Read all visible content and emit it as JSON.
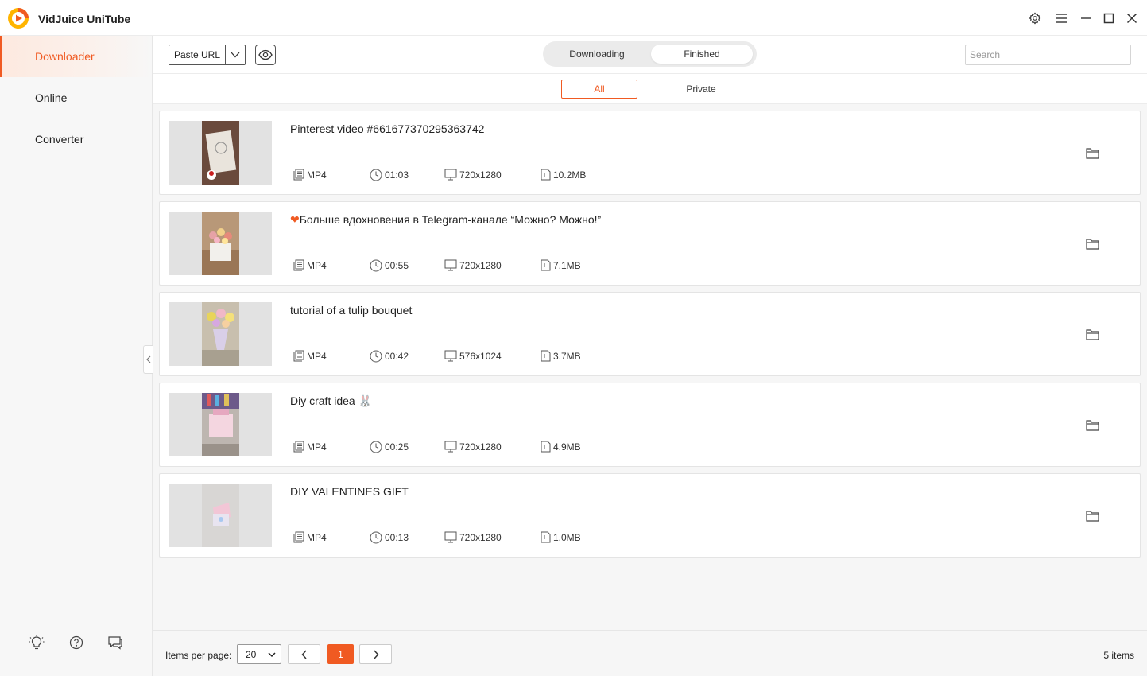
{
  "app": {
    "title": "VidJuice UniTube",
    "accent": "#f05a22"
  },
  "window_controls": [
    "gear-icon",
    "menu-icon",
    "minimize-icon",
    "maximize-icon",
    "close-icon"
  ],
  "sidebar": {
    "items": [
      {
        "label": "Downloader",
        "active": true
      },
      {
        "label": "Online",
        "active": false
      },
      {
        "label": "Converter",
        "active": false
      }
    ],
    "bottom_icons": [
      "lightbulb-icon",
      "help-icon",
      "feedback-icon"
    ]
  },
  "toolbar": {
    "paste_url_label": "Paste URL",
    "tabs": [
      {
        "label": "Downloading",
        "active": false
      },
      {
        "label": "Finished",
        "active": true
      }
    ],
    "search_placeholder": "Search"
  },
  "subtabs": [
    {
      "label": "All",
      "active": true
    },
    {
      "label": "Private",
      "active": false
    }
  ],
  "videos": [
    {
      "title": "Pinterest video #661677370295363742",
      "format": "MP4",
      "duration": "01:03",
      "resolution": "720x1280",
      "size": "10.2MB"
    },
    {
      "title": "Больше вдохновения в Telegram-канале  “Можно? Можно!”",
      "format": "MP4",
      "duration": "00:55",
      "resolution": "720x1280",
      "size": "7.1MB",
      "has_heart": true
    },
    {
      "title": "tutorial of a tulip bouquet",
      "format": "MP4",
      "duration": "00:42",
      "resolution": "576x1024",
      "size": "3.7MB"
    },
    {
      "title": "Diy craft idea ",
      "emoji": "🐰",
      "format": "MP4",
      "duration": "00:25",
      "resolution": "720x1280",
      "size": "4.9MB"
    },
    {
      "title": "DIY VALENTINES GIFT",
      "format": "MP4",
      "duration": "00:13",
      "resolution": "720x1280",
      "size": "1.0MB"
    }
  ],
  "footer": {
    "items_per_page_label": "Items per page:",
    "items_per_page_value": "20",
    "current_page": "1",
    "items_count": "5 items"
  }
}
